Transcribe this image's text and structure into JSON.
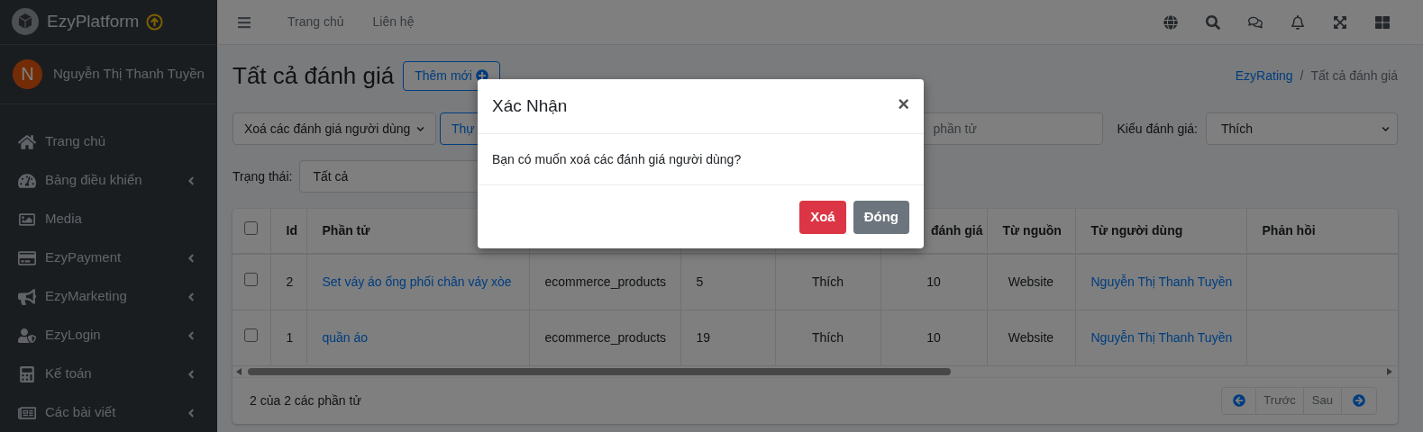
{
  "sidebar": {
    "brand": "EzyPlatform",
    "user": {
      "initial": "N",
      "name": "Nguyễn Thị Thanh Tuyền"
    },
    "items": [
      {
        "label": "Trang chủ",
        "expandable": false
      },
      {
        "label": "Bảng điều khiển",
        "expandable": true
      },
      {
        "label": "Media",
        "expandable": false
      },
      {
        "label": "EzyPayment",
        "expandable": true
      },
      {
        "label": "EzyMarketing",
        "expandable": true
      },
      {
        "label": "EzyLogin",
        "expandable": true
      },
      {
        "label": "Kế toán",
        "expandable": true
      },
      {
        "label": "Các bài viết",
        "expandable": true
      }
    ]
  },
  "topbar": {
    "links": [
      "Trang chủ",
      "Liên hệ"
    ]
  },
  "page": {
    "title": "Tất cả đánh giá",
    "add_button": "Thêm mới",
    "breadcrumb_separator": "/",
    "breadcrumb": [
      {
        "label": "EzyRating",
        "link": true
      },
      {
        "label": "Tất cả đánh giá",
        "link": false
      }
    ]
  },
  "filters": {
    "action_select": "Xoá các đánh giá người dùng",
    "run_button": "Thự",
    "search_placeholder": "phần tử",
    "type_label": "Kiểu đánh giá:",
    "type_value": "Thích",
    "status_label": "Trạng thái:",
    "status_value": "Tất cả"
  },
  "table": {
    "select_all": {
      "checked": false
    },
    "columns": [
      "Id",
      "Phần tử",
      null,
      null,
      null,
      "đánh giá",
      "Từ nguồn",
      "Từ người dùng",
      "Phản hồi"
    ],
    "rows": [
      {
        "checked": false,
        "cells": [
          {
            "text": "2"
          },
          {
            "text": "Set váy áo ống phối chân váy xòe",
            "link": true
          },
          {
            "text": "ecommerce_products"
          },
          {
            "text": "5"
          },
          {
            "text": "Thích"
          },
          {
            "text": "10"
          },
          {
            "text": "Website"
          },
          {
            "text": "Nguyễn Thị Thanh Tuyền",
            "link": true
          },
          {}
        ]
      },
      {
        "checked": false,
        "cells": [
          {
            "text": "1"
          },
          {
            "text": "quần áo",
            "link": true
          },
          {
            "text": "ecommerce_products"
          },
          {
            "text": "19"
          },
          {
            "text": "Thích"
          },
          {
            "text": "10"
          },
          {
            "text": "Website"
          },
          {
            "text": "Nguyễn Thị Thanh Tuyền",
            "link": true
          },
          {}
        ]
      }
    ]
  },
  "footer": {
    "summary": "2 của 2 các phần tử",
    "prev": "Trước",
    "next": "Sau"
  },
  "modal": {
    "title": "Xác Nhận",
    "close": "×",
    "message": "Bạn có muốn xoá các đánh giá người dùng?",
    "buttons": [
      {
        "label": "Xoá",
        "kind": "danger"
      },
      {
        "label": "Đóng",
        "kind": "secondary"
      }
    ]
  }
}
